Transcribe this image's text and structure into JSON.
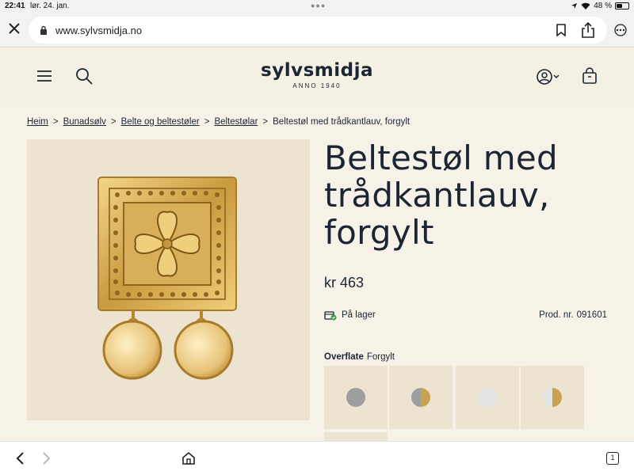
{
  "status_bar": {
    "time": "22:41",
    "date": "lør. 24. jan.",
    "battery_text": "48 %",
    "battery_level": 0.48
  },
  "browser": {
    "url": "www.sylvsmidja.no",
    "open_tabs": "1"
  },
  "site": {
    "brand": "sylvsmidja",
    "tagline": "ANNO 1940"
  },
  "breadcrumb": [
    {
      "label": "Heim",
      "link": true
    },
    {
      "label": "Bunadsølv",
      "link": true
    },
    {
      "label": "Belte og beltestøler",
      "link": true
    },
    {
      "label": "Beltestølar",
      "link": true
    },
    {
      "label": "Beltestøl med trådkantlauv, forgylt",
      "link": false
    }
  ],
  "breadcrumb_separator": ">",
  "product": {
    "title": "Beltestøl med trådkantlauv, forgylt",
    "price": "kr 463",
    "stock_status": "På lager",
    "prod_nr_label": "Prod. nr.",
    "prod_nr": "091601",
    "surface_label": "Overflate",
    "surface_value": "Forgylt"
  },
  "swatches": [
    {
      "name": "silver",
      "color": "#9e9e9e",
      "second": "#9e9e9e"
    },
    {
      "name": "silver-gold",
      "color": "#9e9e9e",
      "second": "#c9a24f"
    },
    {
      "name": "white-silver",
      "color": "#e4e4e4",
      "second": "#e4e4e4"
    },
    {
      "name": "white-gold",
      "color": "#e4e4e4",
      "second": "#c9a24f"
    }
  ],
  "colors": {
    "page_bg": "#f6f2e8",
    "image_bg": "#ece4d1",
    "text": "#1c2533",
    "gold": "#d4aa55",
    "stock_green": "#3e9b4b"
  }
}
